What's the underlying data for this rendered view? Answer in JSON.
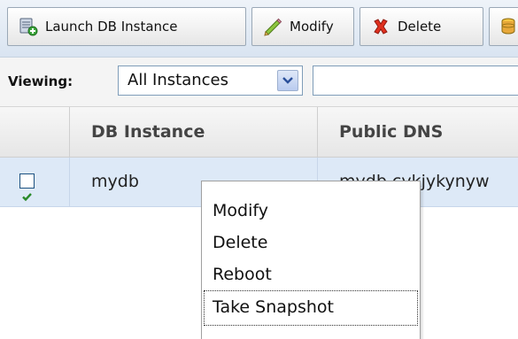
{
  "toolbar": {
    "buttons": [
      {
        "label": "Launch DB Instance",
        "icon": "database-add-icon"
      },
      {
        "label": "Modify",
        "icon": "pencil-icon"
      },
      {
        "label": "Delete",
        "icon": "red-x-icon"
      },
      {
        "label": "",
        "icon": "database-icon"
      }
    ]
  },
  "filter": {
    "label": "Viewing:",
    "selected": "All Instances",
    "search_value": ""
  },
  "table": {
    "columns": [
      "",
      "DB Instance",
      "Public DNS"
    ],
    "rows": [
      {
        "checked": true,
        "db_instance": "mydb",
        "public_dns": "mydb.cykjykynyw"
      }
    ]
  },
  "context_menu": {
    "items": [
      "Modify",
      "Delete",
      "Reboot",
      "Take Snapshot"
    ],
    "focused_index": 3
  },
  "colors": {
    "selected_row": "#dde9f7",
    "toolbar_bg": "#d9e4f1",
    "checkbox_check": "#2a8a2a"
  }
}
